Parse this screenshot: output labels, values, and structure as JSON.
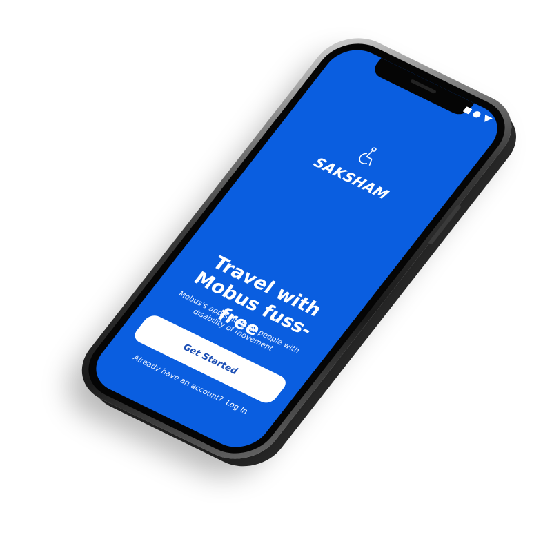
{
  "app": {
    "name": "SAKSHAM",
    "logo_icon": "wheelchair-user-icon"
  },
  "status_bar": {
    "icons": [
      "square-icon",
      "circle-icon",
      "triangle-down-icon"
    ]
  },
  "onboarding": {
    "headline": "Travel with Mobus fuss-free",
    "subtitle": "Mobus's app suited for people with disability of movement",
    "cta_label": "Get Started",
    "login_prompt": "Already have an account?",
    "login_link": "Log In"
  },
  "colors": {
    "screen_bg": "#0a5ee0",
    "cta_bg": "#ffffff",
    "cta_text": "#1c4fb5",
    "text_primary": "#ffffff"
  }
}
